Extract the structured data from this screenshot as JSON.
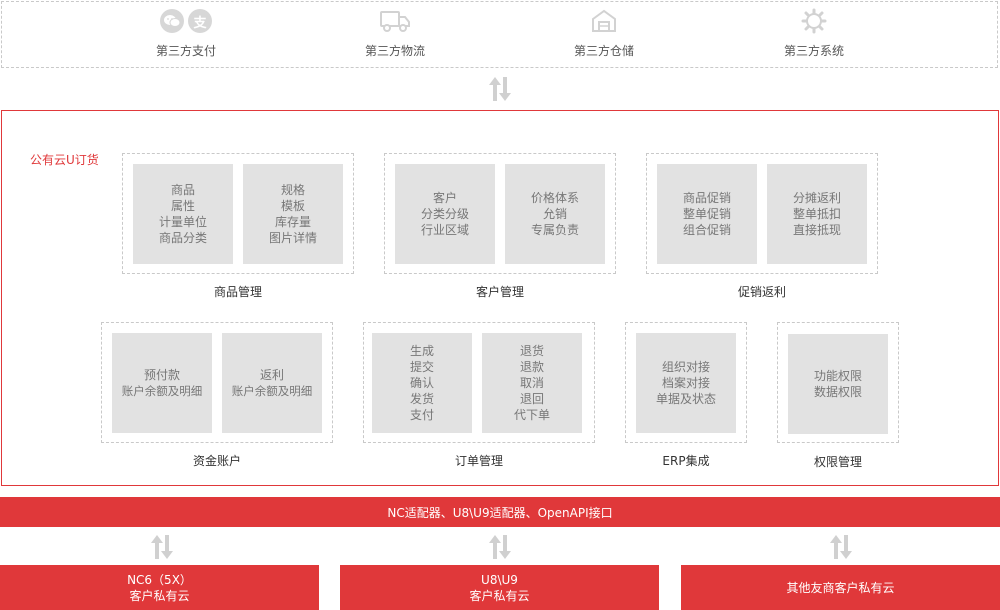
{
  "third_party": {
    "items": [
      {
        "label": "第三方支付",
        "icons": [
          "wechat-icon",
          "alipay-icon"
        ],
        "alipay_glyph": "支"
      },
      {
        "label": "第三方物流",
        "icons": [
          "truck-icon"
        ]
      },
      {
        "label": "第三方仓储",
        "icons": [
          "warehouse-icon"
        ]
      },
      {
        "label": "第三方系统",
        "icons": [
          "gear-icon"
        ]
      }
    ]
  },
  "main": {
    "title": "公有云U订货",
    "groups": [
      {
        "label": "商品管理",
        "cards": [
          [
            "商品",
            "属性",
            "计量单位",
            "商品分类"
          ],
          [
            "规格",
            "模板",
            "库存量",
            "图片详情"
          ]
        ]
      },
      {
        "label": "客户管理",
        "cards": [
          [
            "客户",
            "分类分级",
            "行业区域"
          ],
          [
            "价格体系",
            "允销",
            "专属负责"
          ]
        ]
      },
      {
        "label": "促销返利",
        "cards": [
          [
            "商品促销",
            "整单促销",
            "组合促销"
          ],
          [
            "分摊返利",
            "整单抵扣",
            "直接抵现"
          ]
        ]
      },
      {
        "label": "资金账户",
        "cards": [
          [
            "预付款",
            "账户余额及明细"
          ],
          [
            "返利",
            "账户余额及明细"
          ]
        ]
      },
      {
        "label": "订单管理",
        "cards": [
          [
            "生成",
            "提交",
            "确认",
            "发货",
            "支付"
          ],
          [
            "退货",
            "退款",
            "取消",
            "退回",
            "代下单"
          ]
        ]
      },
      {
        "label": "ERP集成",
        "cards": [
          [
            "组织对接",
            "档案对接",
            "单据及状态"
          ]
        ]
      },
      {
        "label": "权限管理",
        "cards": [
          [
            "功能权限",
            "数据权限"
          ]
        ]
      }
    ]
  },
  "api_bar": {
    "label": "NC适配器、U8\\U9适配器、OpenAPI接口"
  },
  "private_clouds": [
    {
      "line1": "NC6（5X）",
      "line2": "客户私有云"
    },
    {
      "line1": "U8\\U9",
      "line2": "客户私有云"
    },
    {
      "line1": "其他友商客户私有云",
      "line2": ""
    }
  ],
  "colors": {
    "accent": "#e0383a",
    "card_bg": "#e2e2e2",
    "card_text": "#777777",
    "icon": "#d7d7d7"
  }
}
